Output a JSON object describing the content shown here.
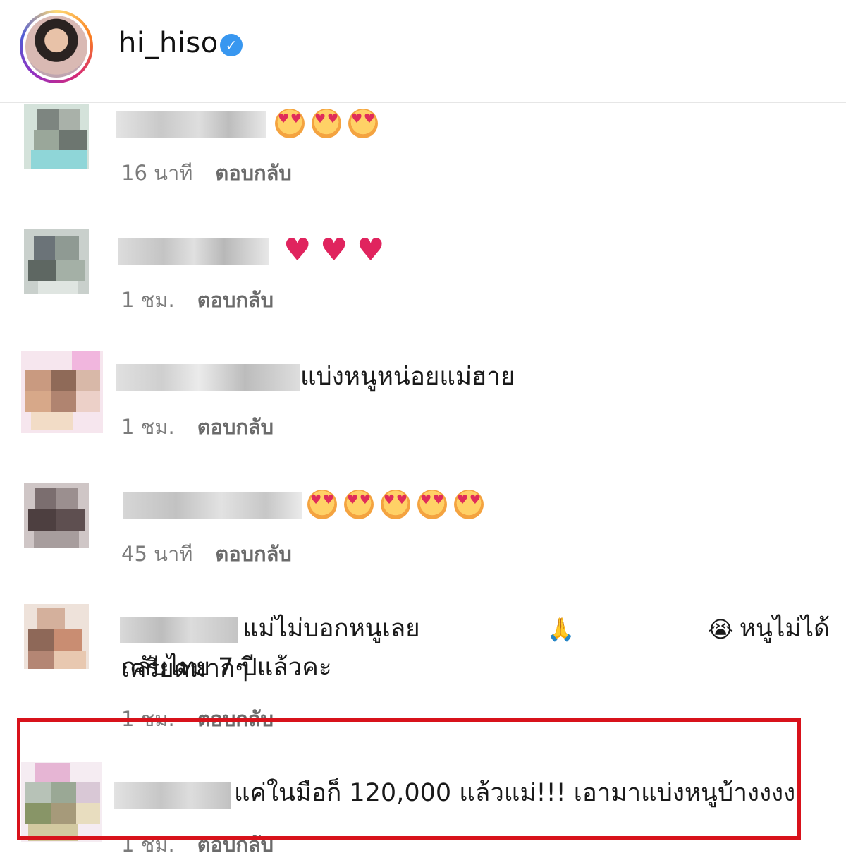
{
  "header": {
    "username": "hi_hiso",
    "verified_symbol": "✓"
  },
  "comments": [
    {
      "text": "",
      "emoji": "heart-eyes",
      "emoji_count": 3,
      "time": "16 นาที",
      "reply": "ตอบกลับ"
    },
    {
      "text": "",
      "emoji": "red-heart",
      "emoji_count": 3,
      "time": "1 ชม.",
      "reply": "ตอบกลับ"
    },
    {
      "text": "แบ่งหนูหน่อยแม่ฮาย",
      "time": "1 ชม.",
      "reply": "ตอบกลับ"
    },
    {
      "text": "",
      "emoji": "heart-eyes",
      "emoji_count": 5,
      "time": "45 นาที",
      "reply": "ตอบกลับ"
    },
    {
      "text_part1": "แม่ไม่บอกหนูเลย",
      "emoji_a": "🙏",
      "emoji_b": "😭",
      "text_part2": "หนูไม่ได้กลับไทย 7 ปีแล้วคะ",
      "text_line2": "เครียดมากๆ",
      "time": "1 ชม.",
      "reply": "ตอบกลับ"
    },
    {
      "text": "แค่ในมือก็ 120,000 แล้วแม่!!! เอามาแบ่งหนูบ้างงงง",
      "time": "1 ชม.",
      "reply": "ตอบกลับ",
      "highlighted": true
    }
  ],
  "colors": {
    "highlight_border": "#d8121b",
    "verified_badge": "#3897f0"
  }
}
